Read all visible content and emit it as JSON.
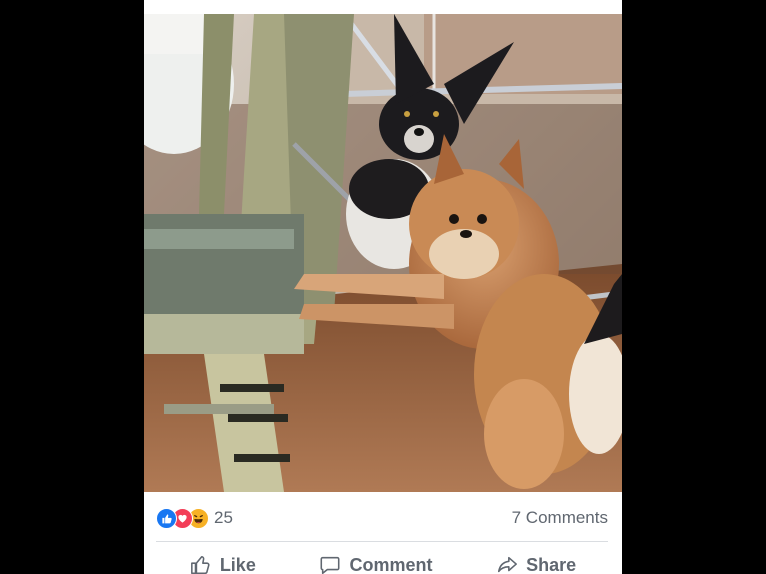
{
  "post": {
    "photo": {
      "subject": "two-dogs-photo"
    },
    "reactions": {
      "icons": [
        "like-reaction-icon",
        "love-reaction-icon",
        "haha-reaction-icon"
      ],
      "count": "25"
    },
    "comments_label": "7 Comments",
    "actions": {
      "like_label": "Like",
      "comment_label": "Comment",
      "share_label": "Share"
    }
  },
  "colors": {
    "like_blue": "#1877f2",
    "love_red": "#f33e58",
    "haha_yellow": "#f7b125",
    "secondary_text": "#606770",
    "divider": "#dadde1"
  }
}
